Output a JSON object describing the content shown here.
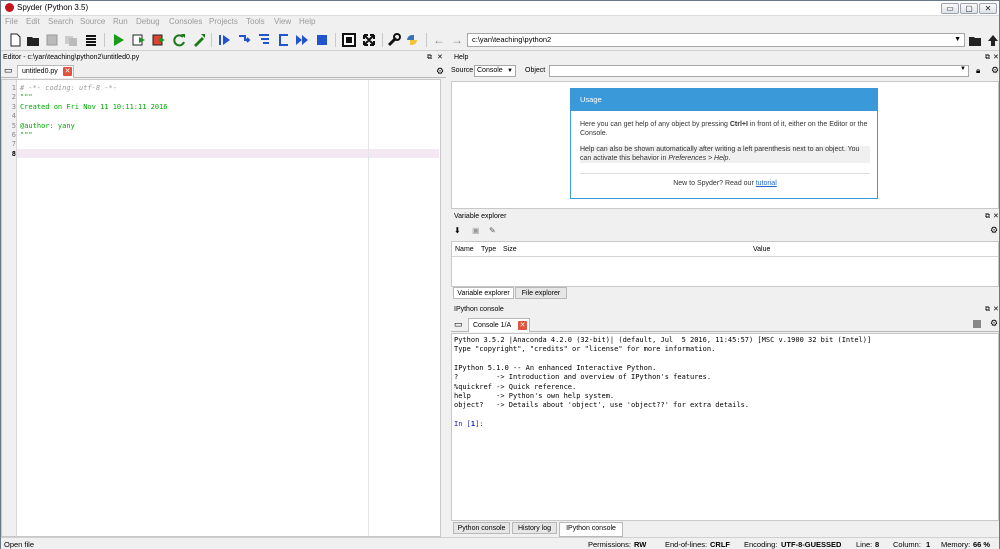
{
  "window": {
    "title": "Spyder (Python 3.5)",
    "minimize": "▭",
    "maximize": "▢",
    "close": "✕"
  },
  "menu": [
    "File",
    "Edit",
    "Search",
    "Source",
    "Run",
    "Debug",
    "Consoles",
    "Projects",
    "Tools",
    "View",
    "Help"
  ],
  "toolbar": {
    "path": "c:\\yan\\teaching\\python2",
    "icons": [
      "new-file-icon",
      "open-file-icon",
      "save-icon",
      "save-all-icon",
      "list-icon",
      "run-icon",
      "run-cell-icon",
      "run-cell-advance-icon",
      "rerun-icon",
      "run-settings-icon",
      "debug-icon",
      "step-icon",
      "step-into-icon",
      "step-return-icon",
      "continue-icon",
      "stop-icon",
      "maximize-pane-icon",
      "fullscreen-icon",
      "preferences-icon",
      "python-path-icon",
      "back-icon",
      "forward-icon",
      "browse-folder-icon",
      "up-folder-icon"
    ]
  },
  "editor": {
    "header": "Editor - c:\\yan\\teaching\\python2\\untitled0.py",
    "tab": "untitled0.py",
    "lines": [
      {
        "n": "1",
        "text": "# -*- coding: utf-8 -*-",
        "color": "#9a9a9a",
        "italic": true
      },
      {
        "n": "2",
        "text": "\"\"\"",
        "color": "#00aa00"
      },
      {
        "n": "3",
        "text": "Created on Fri Nov 11 10:11:11 2016",
        "color": "#00aa00"
      },
      {
        "n": "4",
        "text": "",
        "color": "#00aa00"
      },
      {
        "n": "5",
        "text": "@author: yany",
        "color": "#00aa00"
      },
      {
        "n": "6",
        "text": "\"\"\"",
        "color": "#00aa00"
      },
      {
        "n": "7",
        "text": "",
        "color": "#000"
      },
      {
        "n": "8",
        "text": "",
        "color": "#000"
      }
    ],
    "current_line": "8"
  },
  "help": {
    "title": "Help",
    "source_label": "Source",
    "source_value": "Console",
    "object_label": "Object",
    "usage_title": "Usage",
    "p1a": "Here you can get help of any object by pressing ",
    "p1b": "Ctrl+I",
    "p1c": " in front of it, either on the Editor or the Console.",
    "p2a": "Help can also be shown automatically after writing a left parenthesis next to an object. You can activate this behavior in ",
    "p2b": "Preferences > Help",
    "p2c": ".",
    "p3a": "New to Spyder? Read our ",
    "p3b": "tutorial"
  },
  "variable_explorer": {
    "title": "Variable explorer",
    "columns": [
      "Name",
      "Type",
      "Size",
      "Value"
    ],
    "tabs": [
      "Variable explorer",
      "File explorer"
    ]
  },
  "ipython": {
    "title": "IPython console",
    "tab": "Console 1/A",
    "lines": [
      "Python 3.5.2 |Anaconda 4.2.0 (32-bit)| (default, Jul  5 2016, 11:45:57) [MSC v.1900 32 bit (Intel)]",
      "Type \"copyright\", \"credits\" or \"license\" for more information.",
      "",
      "IPython 5.1.0 -- An enhanced Interactive Python.",
      "?         -> Introduction and overview of IPython's features.",
      "%quickref -> Quick reference.",
      "help      -> Python's own help system.",
      "object?   -> Details about 'object', use 'object??' for extra details.",
      ""
    ],
    "prompt_a": "In [",
    "prompt_n": "1",
    "prompt_b": "]: ",
    "bottom_tabs": [
      "Python console",
      "History log",
      "IPython console"
    ]
  },
  "status": {
    "left": "Open file",
    "permissions_label": "Permissions:",
    "permissions": "RW",
    "eol_label": "End-of-lines:",
    "eol": "CRLF",
    "encoding_label": "Encoding:",
    "encoding": "UTF-8-GUESSED",
    "line_label": "Line:",
    "line": "8",
    "column_label": "Column:",
    "column": "1",
    "memory_label": "Memory:",
    "memory": "66 %"
  }
}
